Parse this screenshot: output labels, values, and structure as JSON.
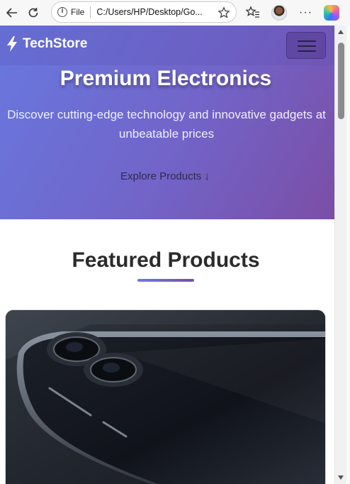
{
  "browser": {
    "scheme_label": "File",
    "url": "C:/Users/HP/Desktop/Go...",
    "icons": [
      "back-arrow-icon",
      "reload-icon",
      "info-icon",
      "star-icon",
      "favorites-icon",
      "profile-avatar",
      "more-icon",
      "copilot-icon"
    ]
  },
  "navbar": {
    "brand": "TechStore",
    "brand_icon": "bolt-icon",
    "menu_icon": "hamburger-icon"
  },
  "hero": {
    "title": "Premium Electronics",
    "subtitle": "Discover cutting-edge technology and innovative gadgets at unbeatable prices",
    "cta": "Explore Products ↓"
  },
  "featured": {
    "title": "Featured Products",
    "products": [
      {
        "image": "smartphone-product-image"
      }
    ]
  },
  "colors": {
    "hero_start": "#6878df",
    "hero_end": "#7b4ea6",
    "accent": "#6a7be0",
    "heading": "#2b2b2b"
  }
}
